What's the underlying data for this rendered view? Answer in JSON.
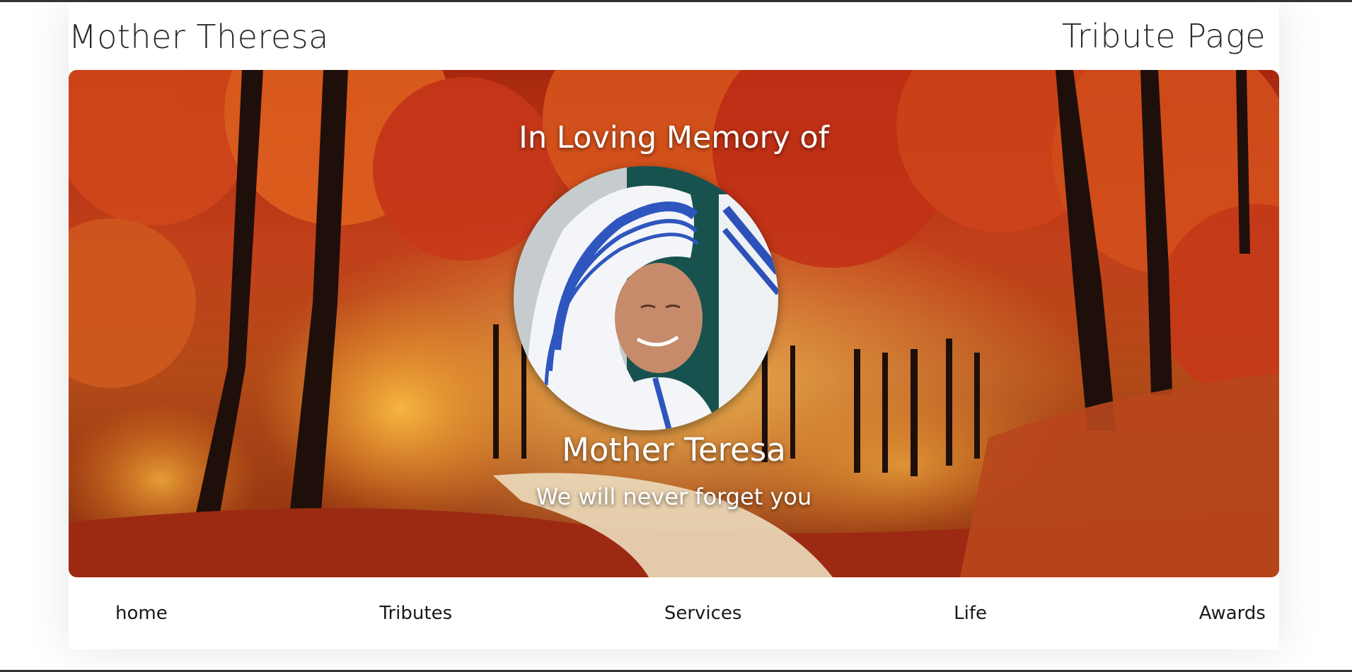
{
  "header": {
    "brand": "Mother Theresa",
    "right_title": "Tribute Page"
  },
  "hero": {
    "heading": "In Loving Memory of",
    "name": "Mother Teresa",
    "tagline": "We will never forget you",
    "portrait_icon": "portrait-photo"
  },
  "nav": {
    "items": [
      {
        "label": "home"
      },
      {
        "label": "Tributes"
      },
      {
        "label": "Services"
      },
      {
        "label": "Life"
      },
      {
        "label": "Awards"
      }
    ]
  },
  "colors": {
    "foliage_red": "#c0341a",
    "foliage_orange": "#e8731c",
    "foliage_gold": "#f2a93b",
    "path": "#e9dcc0",
    "text_dark": "#2a2a2a",
    "hero_text": "#ffffff"
  }
}
